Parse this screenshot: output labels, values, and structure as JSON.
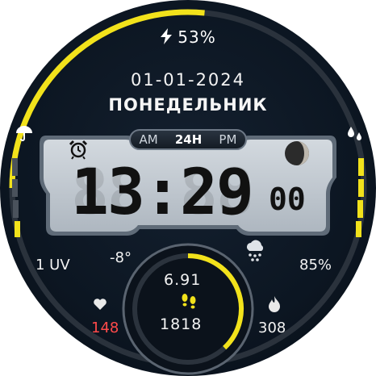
{
  "battery": {
    "percent_text": "53%",
    "level": 0.53,
    "icon": "lightning-bolt-icon"
  },
  "date": "01-01-2024",
  "weekday": "ПОНЕДЕЛЬНИК",
  "time": {
    "hours_minutes": "13:29",
    "seconds": "00",
    "ghost": "88:88",
    "ghost_secs": "88"
  },
  "mode": {
    "am": "AM",
    "h24": "24H",
    "pm": "PM",
    "active": "24H"
  },
  "weather": {
    "temperature": "-8°",
    "icon": "snow-cloud-icon"
  },
  "uv": "1 UV",
  "humidity": "85%",
  "heart_rate": "148",
  "calories": "308",
  "distance": "6.91",
  "steps": "1818",
  "steps_progress": 0.38,
  "colors": {
    "accent": "#f2e21b",
    "heart": "#ff4a4a",
    "bg": "#0c1622",
    "lcd": "#c4ccd3"
  }
}
